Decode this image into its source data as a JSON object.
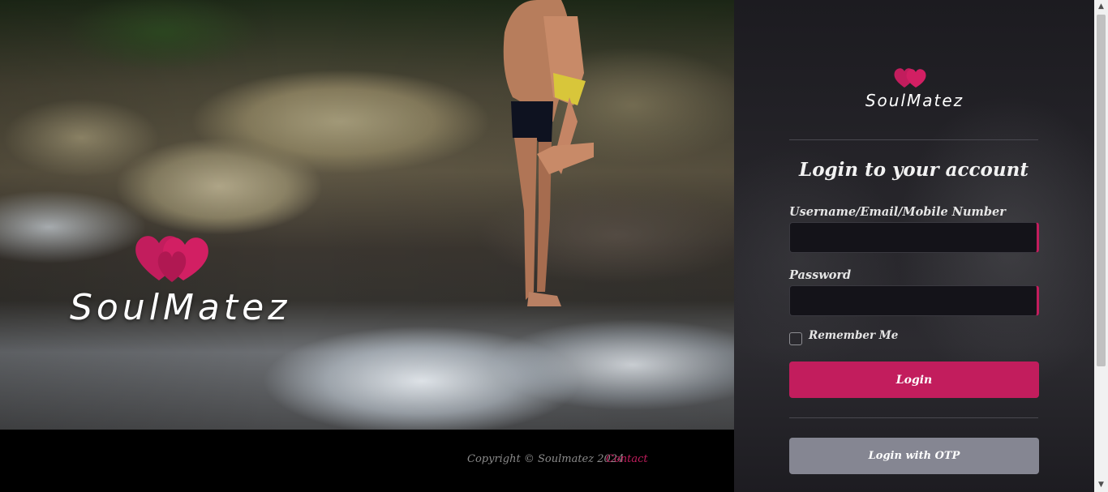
{
  "brand": {
    "name": "SoulMatez",
    "accent_color": "#c21d5d",
    "logo_icon": "double-heart-icon"
  },
  "login_form": {
    "title": "Login to your account",
    "username_label": "Username/Email/Mobile Number",
    "username_value": "",
    "password_label": "Password",
    "password_value": "",
    "remember_label": "Remember Me",
    "remember_checked": false,
    "login_button": "Login",
    "otp_button": "Login with OTP"
  },
  "footer": {
    "copyright": "Copyright © Soulmatez 2024",
    "contact_link": "Contact"
  }
}
